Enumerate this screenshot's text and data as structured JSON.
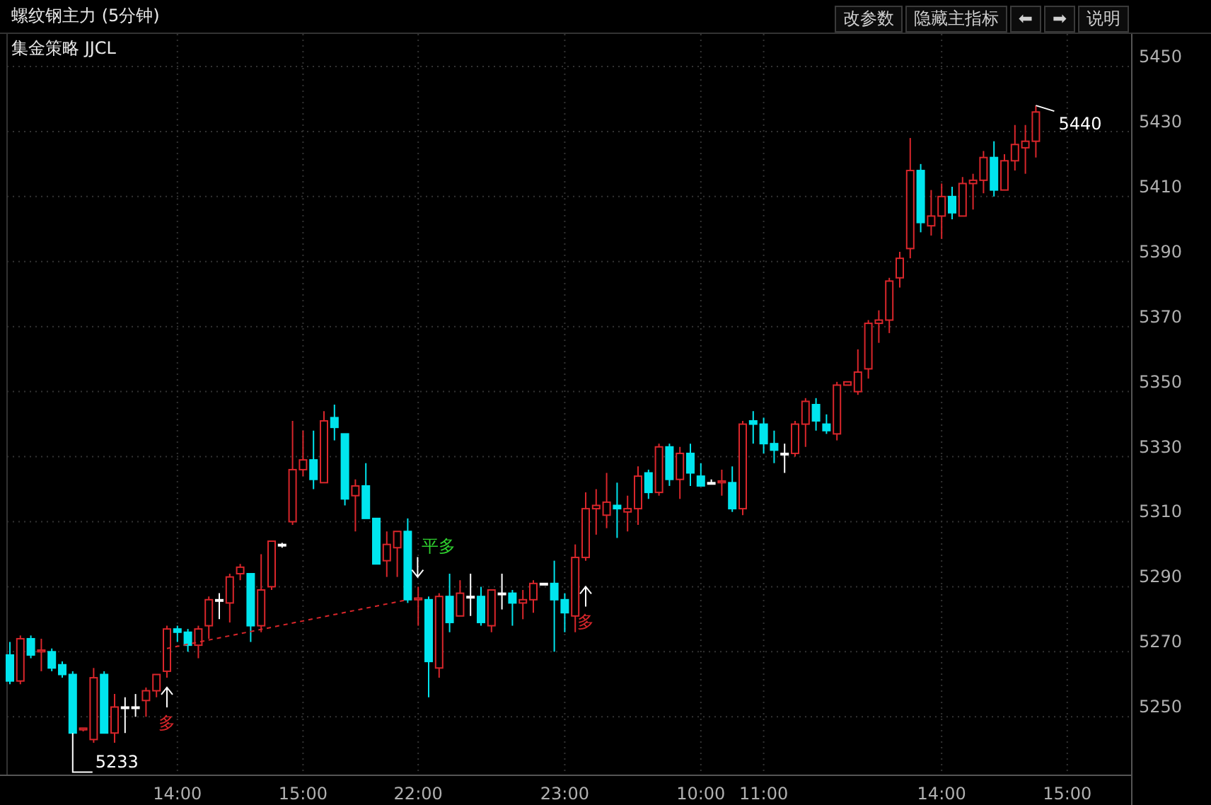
{
  "title": "螺纹钢主力 (5分钟)",
  "buttons": [
    {
      "label": "改参数"
    },
    {
      "label": "隐藏主指标"
    },
    {
      "label": "⬅"
    },
    {
      "label": "➡"
    },
    {
      "label": "说明"
    }
  ],
  "indicator": "集金策略 JJCL",
  "chart_data": {
    "type": "candlestick",
    "yticks": [
      5250,
      5270,
      5290,
      5310,
      5330,
      5350,
      5370,
      5390,
      5410,
      5430,
      5450
    ],
    "ylim": [
      5232,
      5460
    ],
    "grid": true,
    "categories": [
      null,
      null,
      null,
      null,
      null,
      null,
      null,
      null,
      null,
      null,
      null,
      null,
      null,
      null,
      null,
      null,
      "14:00",
      null,
      null,
      null,
      null,
      null,
      null,
      null,
      null,
      null,
      null,
      null,
      "15:00",
      null,
      null,
      null,
      null,
      null,
      null,
      null,
      null,
      null,
      null,
      "22:00",
      null,
      null,
      null,
      null,
      null,
      null,
      null,
      null,
      null,
      null,
      null,
      null,
      null,
      "23:00",
      null,
      null,
      null,
      null,
      null,
      null,
      null,
      null,
      null,
      null,
      null,
      null,
      "10:00",
      null,
      null,
      null,
      null,
      null,
      "11:00",
      null,
      null,
      null,
      null,
      null,
      null,
      null,
      null,
      null,
      null,
      null,
      null,
      null,
      null,
      null,
      null,
      "14:00",
      null,
      null,
      null,
      null,
      null,
      null,
      null,
      null,
      null,
      null,
      null,
      "15:00"
    ],
    "ohlc": [
      [
        5269,
        5273,
        5260,
        5261
      ],
      [
        5261,
        5275,
        5260,
        5274
      ],
      [
        5274,
        5275,
        5268,
        5269
      ],
      [
        5270,
        5274,
        5264,
        5270.5
      ],
      [
        5270,
        5271,
        5264,
        5265
      ],
      [
        5266,
        5267,
        5262,
        5263
      ],
      [
        5263,
        5264,
        5245,
        5245
      ],
      [
        5246,
        5246.5,
        5245.5,
        5246.5
      ],
      [
        5243,
        5265,
        5242,
        5262
      ],
      [
        5263,
        5264,
        5245,
        5245
      ],
      [
        5245,
        5257,
        5242,
        5253
      ],
      [
        5253,
        5256,
        5245,
        5253
      ],
      [
        5253,
        5257,
        5250,
        5253
      ],
      [
        5255,
        5259,
        5250,
        5258
      ],
      [
        5258,
        5263,
        5256,
        5263
      ],
      [
        5264,
        5278,
        5262,
        5277
      ],
      [
        5277,
        5278,
        5273,
        5276
      ],
      [
        5276,
        5277,
        5270,
        5272
      ],
      [
        5272,
        5278,
        5268,
        5277
      ],
      [
        5278,
        5287,
        5274,
        5286
      ],
      [
        5286,
        5288,
        5280,
        5286
      ],
      [
        5285,
        5294,
        5279,
        5293
      ],
      [
        5294,
        5297,
        5292,
        5296
      ],
      [
        5294,
        5294,
        5273,
        5278
      ],
      [
        5278,
        5300,
        5276,
        5289
      ],
      [
        5290,
        5304,
        5289,
        5304
      ],
      [
        5303,
        5303.5,
        5302,
        5303
      ],
      [
        5310,
        5341,
        5309,
        5326
      ],
      [
        5326,
        5338,
        5324,
        5329
      ],
      [
        5329,
        5338,
        5320,
        5323
      ],
      [
        5322,
        5344,
        5322,
        5341
      ],
      [
        5342,
        5346,
        5335,
        5339
      ],
      [
        5337,
        5337,
        5315,
        5317
      ],
      [
        5318,
        5323,
        5307,
        5321
      ],
      [
        5321,
        5328,
        5311,
        5311
      ],
      [
        5311,
        5311,
        5297,
        5297
      ],
      [
        5298,
        5307,
        5293,
        5303
      ],
      [
        5302,
        5307,
        5293,
        5307
      ],
      [
        5307,
        5311,
        5285,
        5286
      ],
      [
        5286,
        5290,
        5278,
        5286.5
      ],
      [
        5286,
        5287,
        5256,
        5267
      ],
      [
        5265,
        5288,
        5262,
        5287
      ],
      [
        5287,
        5294,
        5276,
        5279
      ],
      [
        5281,
        5292,
        5281,
        5288
      ],
      [
        5287,
        5294,
        5281,
        5287
      ],
      [
        5287,
        5290,
        5278,
        5279
      ],
      [
        5278,
        5289,
        5276,
        5289
      ],
      [
        5288,
        5294,
        5283,
        5288
      ],
      [
        5288,
        5289,
        5278,
        5285
      ],
      [
        5285,
        5289,
        5280,
        5286
      ],
      [
        5286,
        5292,
        5282,
        5291
      ],
      [
        5291,
        5291,
        5291,
        5291
      ],
      [
        5291,
        5298,
        5270,
        5286
      ],
      [
        5286,
        5288,
        5276,
        5282
      ],
      [
        5281,
        5303,
        5276,
        5299
      ],
      [
        5299,
        5319,
        5298,
        5314
      ],
      [
        5314,
        5320,
        5306,
        5315
      ],
      [
        5312,
        5325,
        5308,
        5316
      ],
      [
        5315,
        5322,
        5305,
        5314
      ],
      [
        5313,
        5318,
        5307,
        5314
      ],
      [
        5314,
        5327,
        5309,
        5324
      ],
      [
        5325,
        5326,
        5317,
        5319
      ],
      [
        5319,
        5334,
        5318,
        5333
      ],
      [
        5333,
        5334,
        5321,
        5323
      ],
      [
        5323,
        5333,
        5317,
        5331
      ],
      [
        5331,
        5334,
        5321,
        5325
      ],
      [
        5324,
        5328,
        5321,
        5321
      ],
      [
        5322,
        5323,
        5322,
        5322
      ],
      [
        5322,
        5326,
        5318,
        5322.5
      ],
      [
        5322,
        5327,
        5313,
        5314
      ],
      [
        5314,
        5341,
        5312,
        5340
      ],
      [
        5341,
        5344,
        5334,
        5340
      ],
      [
        5340,
        5342,
        5331,
        5334
      ],
      [
        5334,
        5338,
        5328,
        5332
      ],
      [
        5331,
        5334,
        5325,
        5331
      ],
      [
        5331,
        5341,
        5330,
        5340
      ],
      [
        5340,
        5348,
        5333,
        5347
      ],
      [
        5346,
        5348,
        5338,
        5341
      ],
      [
        5340,
        5343,
        5337,
        5338
      ],
      [
        5337,
        5353,
        5335,
        5352
      ],
      [
        5352,
        5353,
        5352,
        5353
      ],
      [
        5350,
        5363,
        5349,
        5356
      ],
      [
        5357,
        5372,
        5354,
        5371
      ],
      [
        5371,
        5375,
        5365,
        5372
      ],
      [
        5372,
        5385,
        5368,
        5384
      ],
      [
        5385,
        5393,
        5382,
        5391
      ],
      [
        5394,
        5428,
        5391,
        5418
      ],
      [
        5418,
        5420,
        5399,
        5402
      ],
      [
        5401,
        5412,
        5398,
        5404
      ],
      [
        5404,
        5414,
        5397,
        5410
      ],
      [
        5410,
        5413,
        5403,
        5405
      ],
      [
        5404,
        5416,
        5404,
        5414
      ],
      [
        5414,
        5417,
        5406,
        5415
      ],
      [
        5415,
        5424,
        5411,
        5422
      ],
      [
        5422,
        5427,
        5410,
        5412
      ],
      [
        5412,
        5423,
        5412,
        5421
      ],
      [
        5421,
        5432,
        5418,
        5426
      ],
      [
        5425,
        5432,
        5417,
        5427
      ],
      [
        5427,
        5438,
        5422,
        5436
      ],
      null,
      null,
      null
    ]
  },
  "markers": [
    {
      "kind": "low",
      "text": "5233"
    },
    {
      "kind": "high",
      "text": "5440"
    },
    {
      "kind": "buy",
      "text": "多"
    },
    {
      "kind": "close_long",
      "text": "平多"
    },
    {
      "kind": "buy",
      "text": "多"
    }
  ]
}
